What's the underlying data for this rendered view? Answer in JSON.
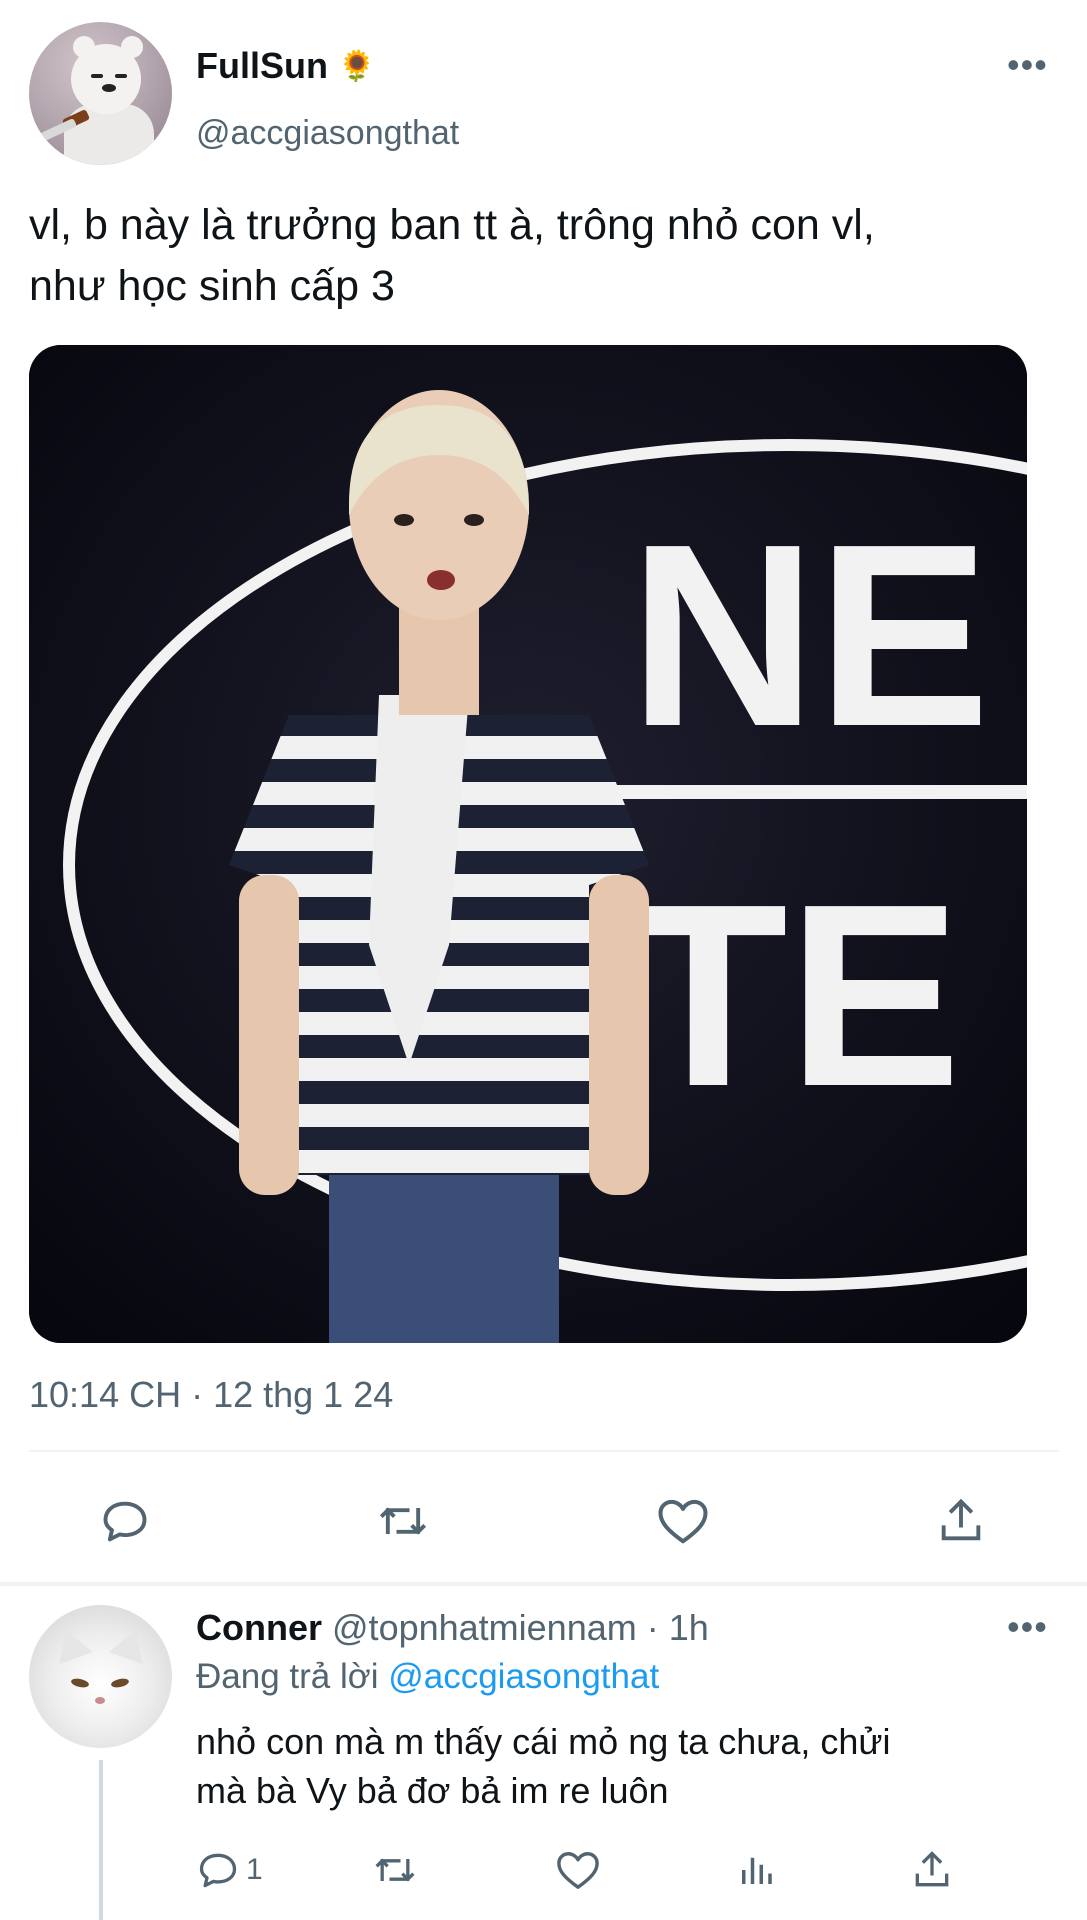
{
  "tweet": {
    "display_name": "FullSun",
    "name_emoji": "🌻",
    "handle": "@accgiasongthat",
    "text": "vl, b này là trưởng ban tt à, trông nhỏ con vl,\nnhư học sinh cấp 3",
    "photo": {
      "backdrop_text": "NE\nTE",
      "icon": "photo-person-striped-shirt"
    },
    "timestamp": "10:14 CH · 12 thg 1 24",
    "more_label": "•••",
    "actions": [
      "reply-icon",
      "retweet-icon",
      "like-icon",
      "share-icon"
    ]
  },
  "reply": {
    "display_name": "Conner",
    "meta": "@topnhatmiennam · 1h",
    "replying_prefix": "Đang trả lời",
    "replying_to": "@accgiasongthat",
    "text": "nhỏ con mà m thấy cái mỏ ng ta chưa, chửi\nmà bà Vy bả đơ bả im re luôn",
    "reply_count": "1",
    "more_label": "•••",
    "actions": [
      "reply-icon",
      "retweet-icon",
      "like-icon",
      "views-icon",
      "share-icon"
    ]
  },
  "colors": {
    "text": "#0f1419",
    "secondary": "#536471",
    "link": "#1d9bf0",
    "divider": "#eff3f4"
  }
}
